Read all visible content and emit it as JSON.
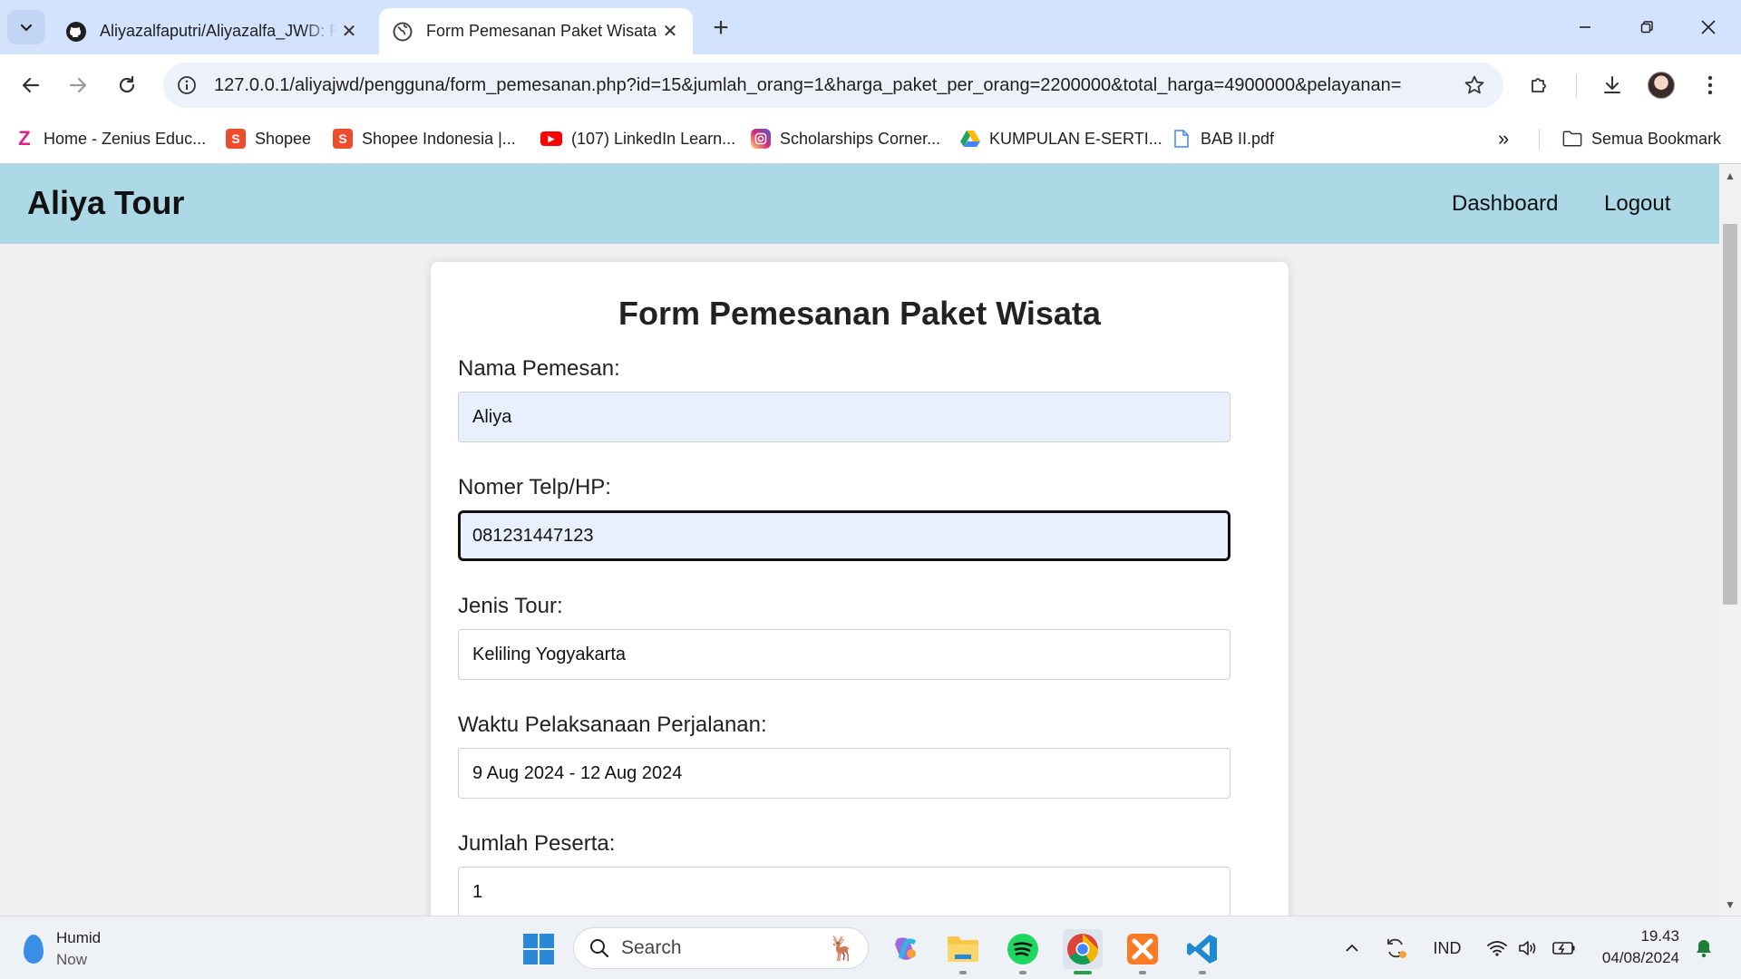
{
  "browser": {
    "tabs": [
      {
        "title": "Aliyazalfaputri/Aliyazalfa_JWD: Form Pemesanan",
        "icon": "github-icon"
      },
      {
        "title": "Form Pemesanan Paket Wisata",
        "icon": "globe-icon"
      }
    ],
    "url": "127.0.0.1/aliyajwd/pengguna/form_pemesanan.php?id=15&jumlah_orang=1&harga_paket_per_orang=2200000&total_harga=4900000&pelayanan=",
    "bookmarks": [
      {
        "label": "Home - Zenius Educ...",
        "icon": "zenius-icon",
        "color": "#e0218a"
      },
      {
        "label": "Shopee",
        "icon": "shopee-icon",
        "color": "#ee4d2d"
      },
      {
        "label": "Shopee Indonesia |...",
        "icon": "shopee-icon",
        "color": "#ee4d2d"
      },
      {
        "label": "(107) LinkedIn Learn...",
        "icon": "youtube-icon",
        "color": "#ff0000"
      },
      {
        "label": "Scholarships Corner...",
        "icon": "instagram-icon",
        "color": "#d62976"
      },
      {
        "label": "KUMPULAN E-SERTI...",
        "icon": "google-drive-icon",
        "color": "#1fa463"
      },
      {
        "label": "BAB II.pdf",
        "icon": "document-icon",
        "color": "#4285f4"
      }
    ],
    "all_bookmarks_label": "Semua Bookmark"
  },
  "site": {
    "brand": "Aliya Tour",
    "nav": {
      "dashboard": "Dashboard",
      "logout": "Logout"
    },
    "header_color": "#add8e6"
  },
  "form": {
    "title": "Form Pemesanan Paket Wisata",
    "fields": [
      {
        "label": "Nama Pemesan:",
        "value": "Aliya"
      },
      {
        "label": "Nomer Telp/HP:",
        "value": "081231447123"
      },
      {
        "label": "Jenis Tour:",
        "value": "Keliling Yogyakarta"
      },
      {
        "label": "Waktu Pelaksanaan Perjalanan:",
        "value": "9 Aug 2024 - 12 Aug 2024"
      },
      {
        "label": "Jumlah Peserta:",
        "value": "1"
      }
    ]
  },
  "taskbar": {
    "weather": {
      "condition": "Humid",
      "time": "Now"
    },
    "search_placeholder": "Search",
    "language": "IND",
    "clock": {
      "time": "19.43",
      "date": "04/08/2024"
    }
  }
}
